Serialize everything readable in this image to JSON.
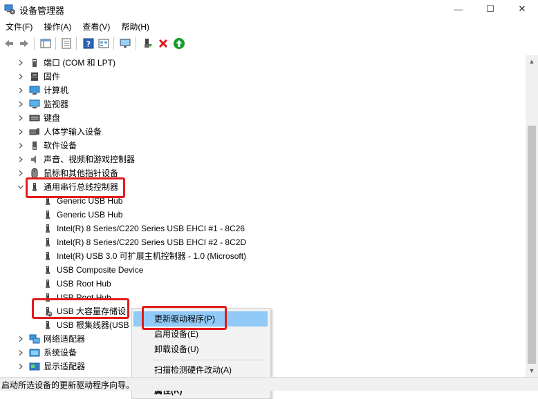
{
  "window": {
    "title": "设备管理器",
    "minimize": "—",
    "maximize": "☐",
    "close": "✕"
  },
  "menu": [
    "文件(F)",
    "操作(A)",
    "查看(V)",
    "帮助(H)"
  ],
  "tree": {
    "categories_top": [
      {
        "label": "端口 (COM 和 LPT)",
        "icon": "port-icon"
      },
      {
        "label": "固件",
        "icon": "firmware-icon"
      },
      {
        "label": "计算机",
        "icon": "computer-icon"
      },
      {
        "label": "监视器",
        "icon": "monitor-icon"
      },
      {
        "label": "键盘",
        "icon": "keyboard-icon"
      },
      {
        "label": "人体学输入设备",
        "icon": "hid-icon"
      },
      {
        "label": "软件设备",
        "icon": "software-device-icon"
      },
      {
        "label": "声音、视频和游戏控制器",
        "icon": "sound-icon"
      },
      {
        "label": "鼠标和其他指针设备",
        "icon": "mouse-icon"
      }
    ],
    "usb_category": "通用串行总线控制器",
    "usb_children": [
      "Generic USB Hub",
      "Generic USB Hub",
      "Intel(R) 8 Series/C220 Series USB EHCI #1 - 8C26",
      "Intel(R) 8 Series/C220 Series USB EHCI #2 - 8C2D",
      "Intel(R) USB 3.0 可扩展主机控制器 - 1.0 (Microsoft)",
      "USB Composite Device",
      "USB Root Hub",
      "USB Root Hub",
      "USB 大容量存储设",
      "USB 根集线器(USB"
    ],
    "categories_bottom": [
      {
        "label": "网络适配器",
        "icon": "network-icon"
      },
      {
        "label": "系统设备",
        "icon": "system-device-icon"
      },
      {
        "label": "显示适配器",
        "icon": "display-adapter-icon"
      }
    ]
  },
  "context_menu": {
    "items": [
      "更新驱动程序(P)",
      "启用设备(E)",
      "卸载设备(U)",
      "扫描检测硬件改动(A)",
      "属性(R)"
    ]
  },
  "status": "启动所选设备的更新驱动程序向导。",
  "colors": {
    "highlight_box": "#e51a1a",
    "menu_hover": "#91c9f7"
  }
}
